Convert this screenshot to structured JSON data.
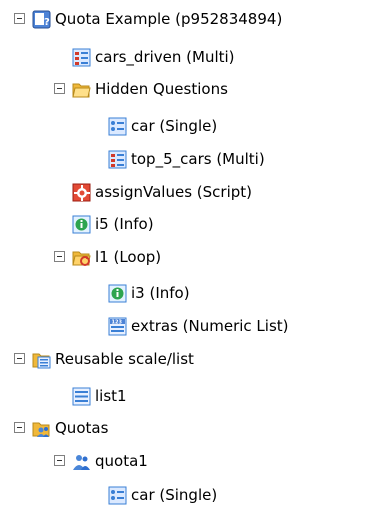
{
  "tree": {
    "root": {
      "label": "Quota Example (p952834894)",
      "icon": "survey-icon"
    },
    "cars_driven": {
      "label": "cars_driven (Multi)",
      "icon": "multi-question-icon"
    },
    "hidden_questions": {
      "label": "Hidden Questions",
      "icon": "folder-open-icon"
    },
    "car": {
      "label": "car (Single)",
      "icon": "single-question-icon"
    },
    "top_5_cars": {
      "label": "top_5_cars (Multi)",
      "icon": "multi-question-icon"
    },
    "assign_values": {
      "label": "assignValues (Script)",
      "icon": "script-gear-icon"
    },
    "i5": {
      "label": "i5 (Info)",
      "icon": "info-icon"
    },
    "l1": {
      "label": "l1 (Loop)",
      "icon": "loop-folder-icon"
    },
    "i3": {
      "label": "i3 (Info)",
      "icon": "info-icon"
    },
    "extras": {
      "label": "extras (Numeric List)",
      "icon": "numeric-list-icon"
    },
    "reusable": {
      "label": "Reusable scale/list",
      "icon": "reusable-list-folder-icon"
    },
    "list1": {
      "label": "list1",
      "icon": "list-icon"
    },
    "quotas": {
      "label": "Quotas",
      "icon": "quotas-folder-icon"
    },
    "quota1": {
      "label": "quota1",
      "icon": "users-icon"
    },
    "quota_car": {
      "label": "car (Single)",
      "icon": "single-question-icon"
    }
  },
  "colors": {
    "folder": "#f5c542",
    "question_blue": "#3a7fd5",
    "multi_red": "#d23a2a",
    "script_red": "#d32b1e",
    "info_green": "#2ea44f",
    "users_blue": "#4a86d8"
  }
}
